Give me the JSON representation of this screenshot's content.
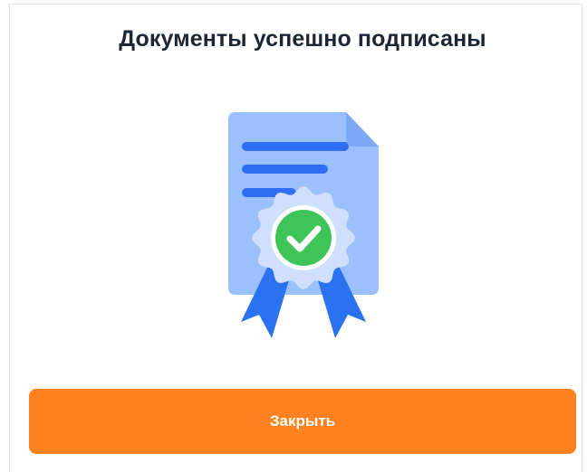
{
  "dialog": {
    "title": "Документы успешно подписаны",
    "close_label": "Закрыть"
  },
  "illustration": {
    "icon": "signed-certificate-icon",
    "badge_icon": "checkmark-icon"
  },
  "colors": {
    "accent": "#ff8120",
    "document": "#9cc0fc",
    "document_lines": "#2f6ef2",
    "ribbon": "#2a72f0",
    "seal": "#cfe0fd",
    "check": "#3fc459",
    "title": "#1d2633"
  }
}
